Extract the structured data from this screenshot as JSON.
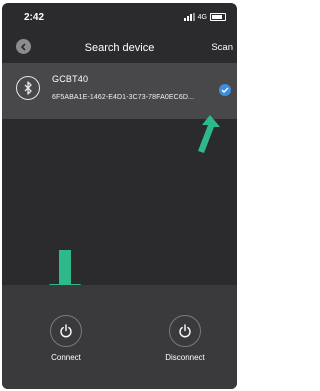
{
  "status_bar": {
    "time": "2:42",
    "network": "4G"
  },
  "nav": {
    "title": "Search device",
    "scan_label": "Scan"
  },
  "device": {
    "name": "GCBT40",
    "id": "6F5ABA1E-1462-E4D1-3C73-78FA0EC6D..."
  },
  "actions": {
    "connect_label": "Connect",
    "disconnect_label": "Disconnect"
  },
  "colors": {
    "accent": "#3c8fe0",
    "arrow": "#2eb98a",
    "background": "#2b2b2d"
  }
}
